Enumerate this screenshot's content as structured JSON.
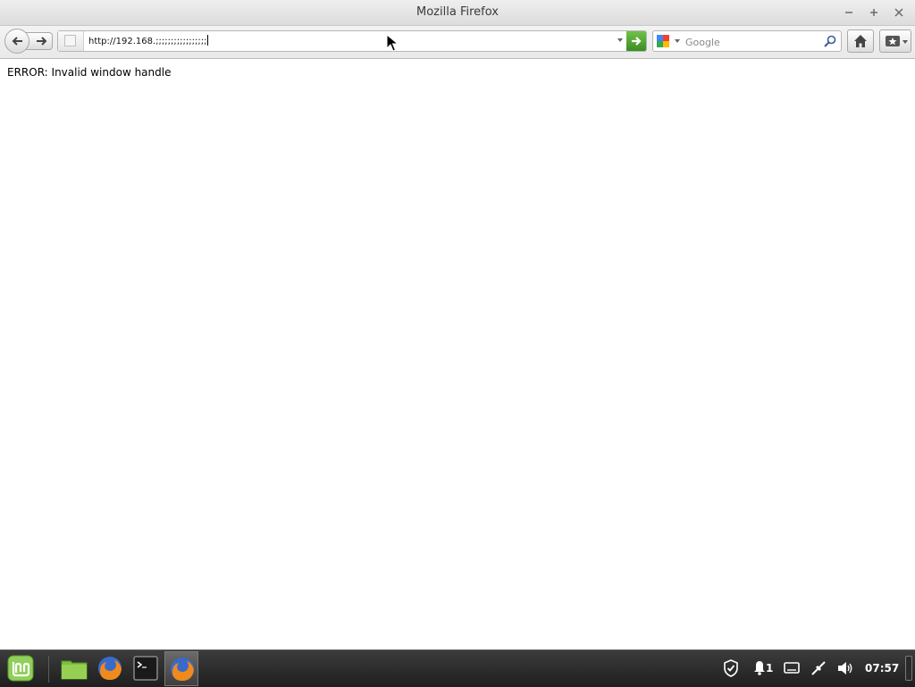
{
  "window": {
    "title": "Mozilla Firefox"
  },
  "toolbar": {
    "url": "http://192.168.;;;;;;;;;;;;;;;;;",
    "search_placeholder": "Google",
    "search_engine_icon": "google-icon"
  },
  "page": {
    "error_message": "ERROR: Invalid window handle"
  },
  "taskbar": {
    "notification_count": "1",
    "clock": "07:57",
    "apps": [
      "mint-menu-icon",
      "file-manager-icon",
      "firefox-icon",
      "terminal-icon",
      "firefox-icon"
    ]
  },
  "colors": {
    "go_button": "#4a9e2e",
    "taskbar": "#2a2a2a"
  }
}
